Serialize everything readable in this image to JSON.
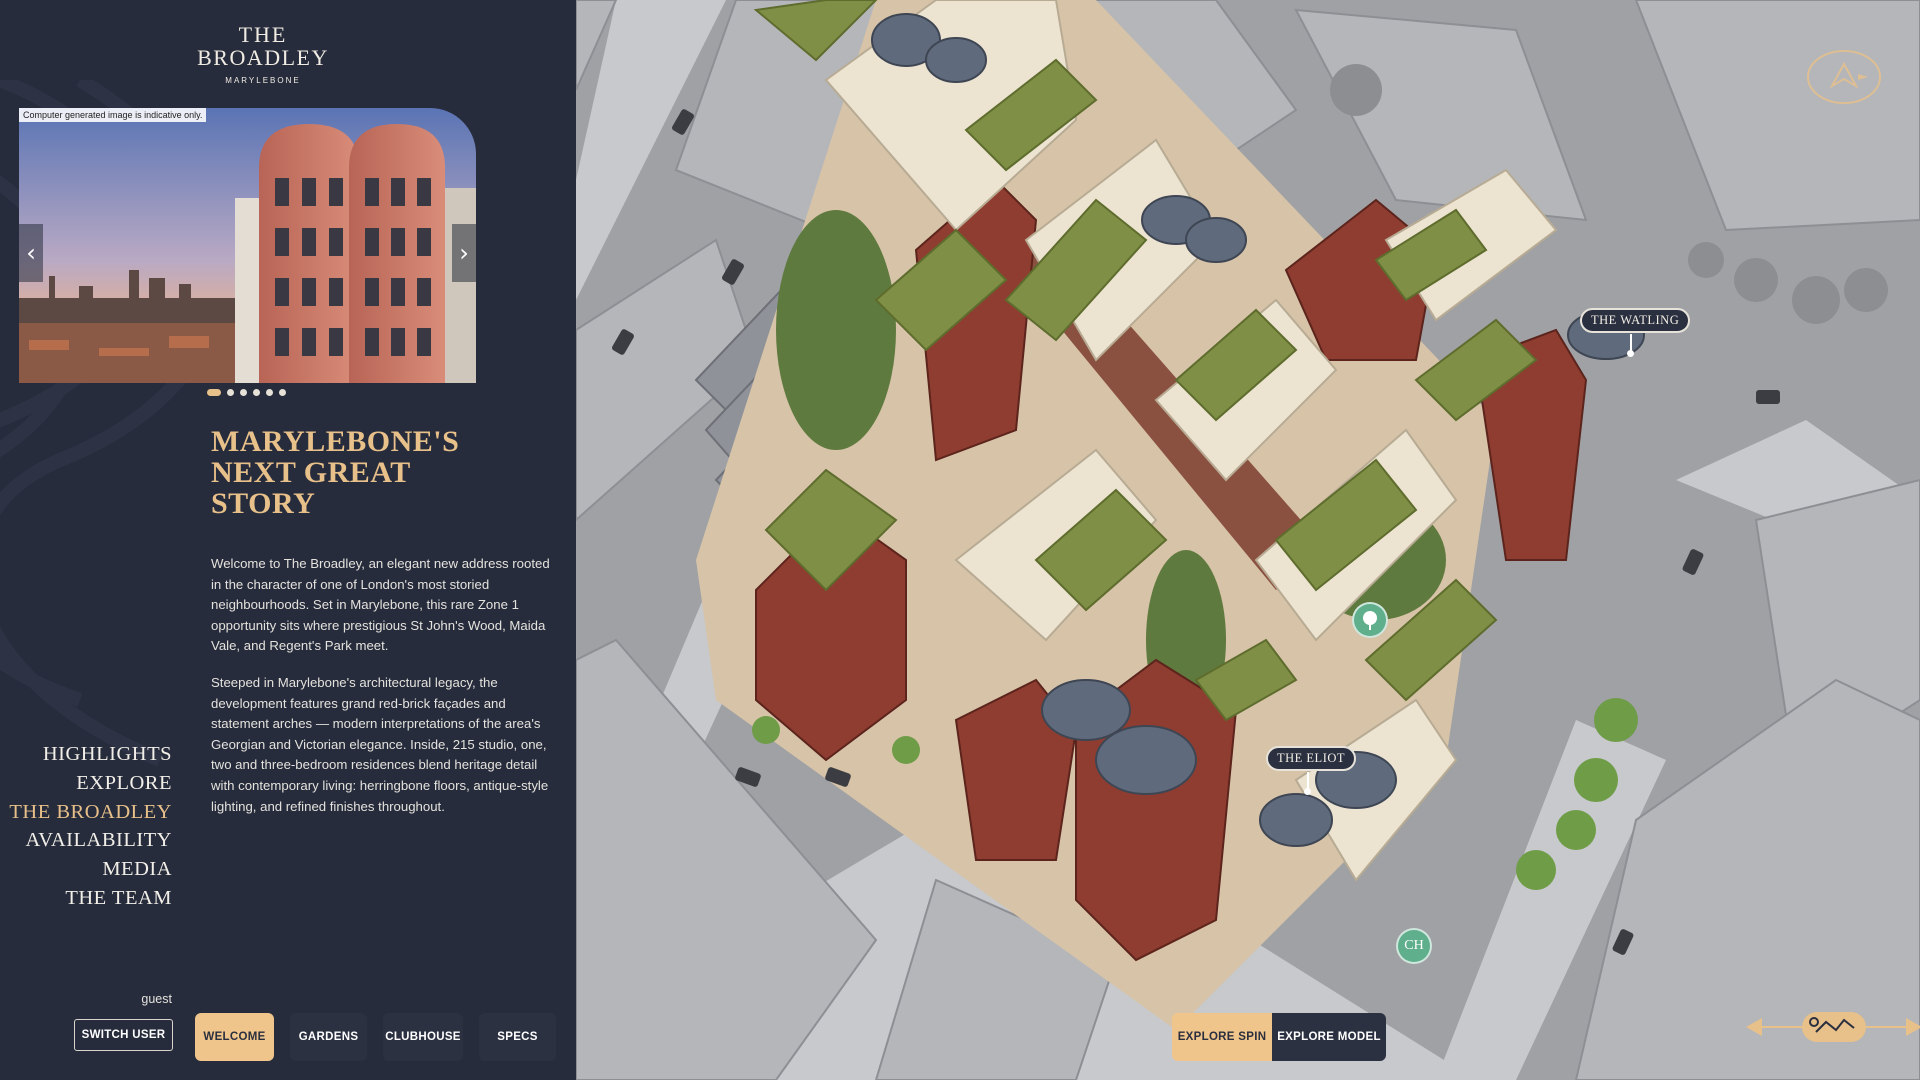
{
  "logo": {
    "line1": "THE",
    "line2": "BROADLEY",
    "line3": "MARYLEBONE"
  },
  "gallery": {
    "disclaimer": "Computer generated image is indicative only.",
    "prev_icon": "chevron-left-icon",
    "next_icon": "chevron-right-icon",
    "prev_glyph": "‹",
    "next_glyph": "›",
    "slide_count": 6,
    "active_slide": 1
  },
  "headline": {
    "line1": "MARYLEBONE'S",
    "line2": "NEXT GREAT",
    "line3": "STORY"
  },
  "body": {
    "p1": "Welcome to The Broadley, an elegant new address rooted in the character of one of London's most storied neighbourhoods. Set in Marylebone, this rare Zone 1 opportunity sits where prestigious St John's Wood, Maida Vale, and Regent's Park meet.",
    "p2": "Steeped in Marylebone's architectural legacy, the development features grand red-brick façades and statement arches — modern interpretations of the area's Georgian and Victorian elegance. Inside, 215 studio, one, two and three-bedroom residences blend heritage detail with contemporary living: herringbone floors, antique-style lighting, and refined finishes throughout."
  },
  "nav": {
    "items": [
      {
        "label": "HIGHLIGHTS"
      },
      {
        "label": "EXPLORE"
      },
      {
        "label": "THE BROADLEY"
      },
      {
        "label": "AVAILABILITY"
      },
      {
        "label": "MEDIA"
      },
      {
        "label": "THE TEAM"
      }
    ],
    "active": "THE BROADLEY"
  },
  "user": {
    "name": "guest",
    "switch_label": "SWITCH USER"
  },
  "tabs": {
    "welcome": "WELCOME",
    "gardens": "GARDENS",
    "clubhouse": "CLUBHOUSE",
    "specs": "SPECS",
    "active": "WELCOME"
  },
  "map": {
    "labels": {
      "watling": "THE WATLING",
      "eliot": "THE ELIOT"
    },
    "poi": {
      "garden_icon": "tree-icon",
      "clubhouse_icon": "clubhouse-icon",
      "clubhouse_glyph": "CH"
    },
    "explore": {
      "spin": "EXPLORE SPIN",
      "model": "EXPLORE MODEL",
      "active": "EXPLORE SPIN"
    },
    "rotate_icon": "rotate-view-icon",
    "compass_icon": "compass-icon"
  },
  "colors": {
    "panel": "#272c3d",
    "accent": "#e8c089",
    "button_dark": "#2c3142",
    "poi_green": "#5fae8c"
  }
}
